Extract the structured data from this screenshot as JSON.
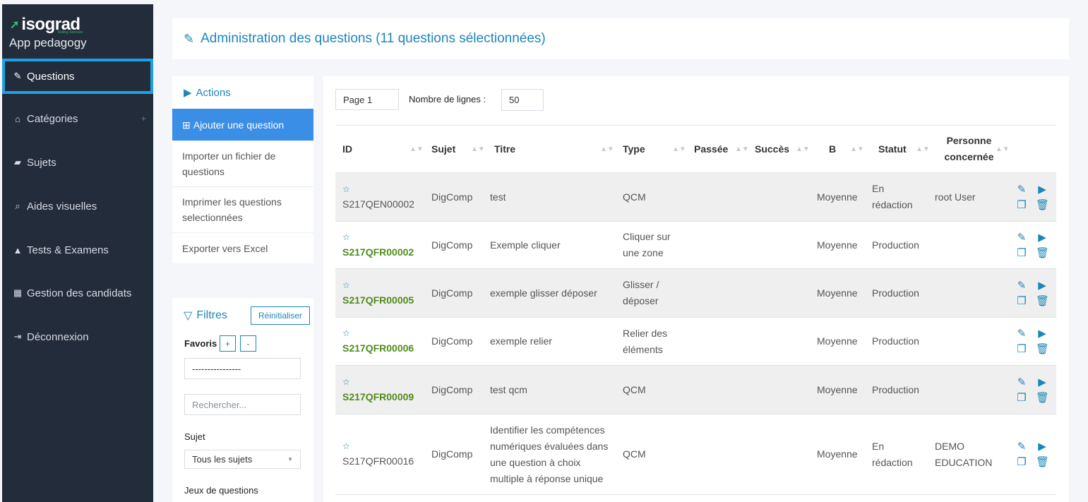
{
  "sidebar": {
    "brand": "isograd",
    "brand_sub": "Testing Services",
    "app_name": "App pedagogy",
    "items": [
      {
        "label": "Questions",
        "icon": "edit-square-icon"
      },
      {
        "label": "Catégories",
        "icon": "sitemap-icon"
      },
      {
        "label": "Sujets",
        "icon": "folder-open-icon"
      },
      {
        "label": "Aides visuelles",
        "icon": "search-icon"
      },
      {
        "label": "Tests & Examens",
        "icon": "graduation-cap-icon"
      },
      {
        "label": "Gestion des candidats",
        "icon": "keyboard-icon"
      },
      {
        "label": "Déconnexion",
        "icon": "sign-out-icon"
      }
    ],
    "accent": "#1fa0e3"
  },
  "header": {
    "title": "Administration des questions (11 questions sélectionnées)",
    "color": "#1c86b8"
  },
  "actions": {
    "title": "Actions",
    "items": [
      {
        "label": "Ajouter une question"
      },
      {
        "label": "Importer un fichier de questions"
      },
      {
        "label": "Imprimer les questions selectionnées"
      },
      {
        "label": "Exporter vers Excel"
      }
    ]
  },
  "filters": {
    "title": "Filtres",
    "reset": "Réinitialiser",
    "favoris_label": "Favoris",
    "plus": "+",
    "minus": "-",
    "favoris_value": "----------------",
    "search_placeholder": "Rechercher...",
    "sujet_label": "Sujet",
    "sujet_value": "Tous les sujets",
    "jeux_label": "Jeux de questions"
  },
  "table": {
    "page": "Page 1",
    "rows_label": "Nombre de lignes :",
    "rows_value": "50",
    "headers": [
      "ID",
      "Sujet",
      "Titre",
      "Type",
      "Passée",
      "Succès",
      "B",
      "Statut",
      "Personne concernée"
    ],
    "rows": [
      {
        "id": "S217QEN00002",
        "green": false,
        "sujet": "DigComp",
        "titre": "test",
        "type": "QCM",
        "b": "Moyenne",
        "statut": "En rédaction",
        "personne": "root User"
      },
      {
        "id": "S217QFR00002",
        "green": true,
        "sujet": "DigComp",
        "titre": "Exemple cliquer",
        "type": "Cliquer sur une zone",
        "b": "Moyenne",
        "statut": "Production",
        "personne": ""
      },
      {
        "id": "S217QFR00005",
        "green": true,
        "sujet": "DigComp",
        "titre": "exemple glisser déposer",
        "type": "Glisser / déposer",
        "b": "Moyenne",
        "statut": "Production",
        "personne": ""
      },
      {
        "id": "S217QFR00006",
        "green": true,
        "sujet": "DigComp",
        "titre": "exemple relier",
        "type": "Relier des éléments",
        "b": "Moyenne",
        "statut": "Production",
        "personne": ""
      },
      {
        "id": "S217QFR00009",
        "green": true,
        "sujet": "DigComp",
        "titre": "test qcm",
        "type": "QCM",
        "b": "Moyenne",
        "statut": "Production",
        "personne": ""
      },
      {
        "id": "S217QFR00016",
        "green": false,
        "sujet": "DigComp",
        "titre": "Identifier les compétences numériques évaluées dans une question à choix multiple à réponse unique",
        "type": "QCM",
        "b": "Moyenne",
        "statut": "En rédaction",
        "personne": "DEMO EDUCATION"
      }
    ],
    "id_color_green": "#4e8c1b"
  }
}
